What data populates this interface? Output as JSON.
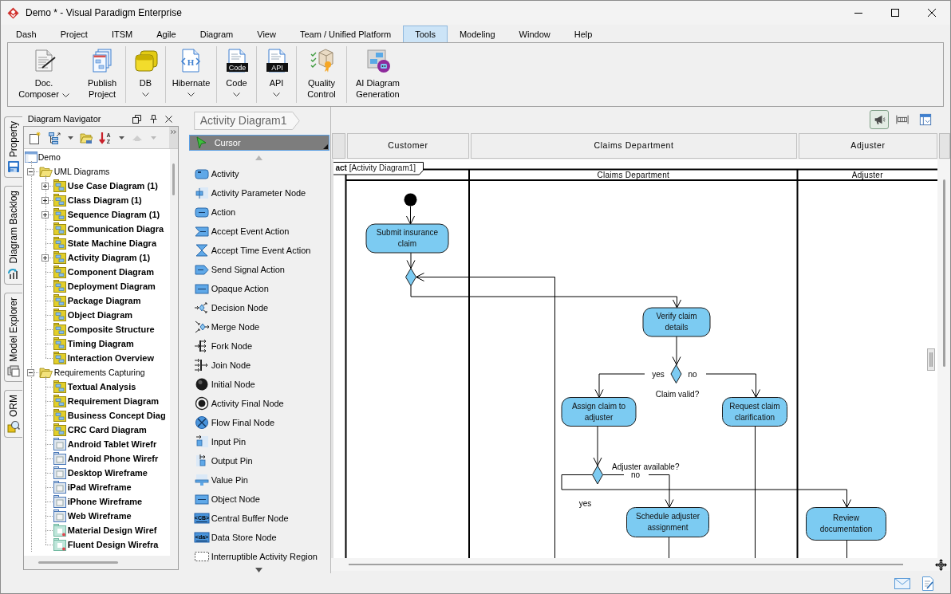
{
  "window": {
    "title": "Demo * - Visual Paradigm Enterprise"
  },
  "menu_tabs": [
    {
      "label": "Dash",
      "selected": false
    },
    {
      "label": "Project",
      "selected": false
    },
    {
      "label": "ITSM",
      "selected": false
    },
    {
      "label": "Agile",
      "selected": false
    },
    {
      "label": "Diagram",
      "selected": false
    },
    {
      "label": "View",
      "selected": false
    },
    {
      "label": "Team / Unified Platform",
      "selected": false
    },
    {
      "label": "Tools",
      "selected": true
    },
    {
      "label": "Modeling",
      "selected": false
    },
    {
      "label": "Window",
      "selected": false
    },
    {
      "label": "Help",
      "selected": false
    }
  ],
  "ribbon": [
    {
      "label": "Doc. Composer",
      "kind": "split"
    },
    {
      "label": "Publish Project",
      "kind": "button"
    },
    {
      "label": "DB",
      "kind": "dropdown"
    },
    {
      "label": "Hibernate",
      "kind": "dropdown",
      "icon_text": "H"
    },
    {
      "label": "Code",
      "kind": "dropdown",
      "icon_text": "Code"
    },
    {
      "label": "API",
      "kind": "dropdown",
      "icon_text": "API"
    },
    {
      "label": "Quality Control",
      "kind": "button"
    },
    {
      "label": "AI Diagram Generation",
      "kind": "button"
    }
  ],
  "side_tabs": [
    {
      "label": "Property"
    },
    {
      "label": "Diagram Backlog"
    },
    {
      "label": "Model Explorer"
    },
    {
      "label": "ORM"
    }
  ],
  "navigator": {
    "title": "Diagram Navigator",
    "toolbar": [
      {
        "disabled": false
      },
      {
        "disabled": false
      },
      {
        "disabled": false
      },
      {
        "disabled": false,
        "icon_text": "AZ"
      },
      {
        "disabled": true
      }
    ],
    "tree": {
      "label": "Demo",
      "children": [
        {
          "label": "UML Diagrams",
          "kind": "folder",
          "has_children": true,
          "expanded": true,
          "children": [
            {
              "label": "Use Case Diagram (1)",
              "kind": "diagram",
              "has_children": true,
              "expanded": false
            },
            {
              "label": "Class Diagram (1)",
              "kind": "diagram",
              "has_children": true,
              "expanded": false
            },
            {
              "label": "Sequence Diagram (1)",
              "kind": "diagram",
              "has_children": true,
              "expanded": false
            },
            {
              "label": "Communication Diagra",
              "kind": "diagram",
              "has_children": false,
              "expanded": false
            },
            {
              "label": "State Machine Diagra",
              "kind": "diagram",
              "has_children": false,
              "expanded": false
            },
            {
              "label": "Activity Diagram (1)",
              "kind": "diagram",
              "has_children": true,
              "expanded": false
            },
            {
              "label": "Component Diagram",
              "kind": "diagram",
              "has_children": false,
              "expanded": false
            },
            {
              "label": "Deployment Diagram",
              "kind": "diagram",
              "has_children": false,
              "expanded": false
            },
            {
              "label": "Package Diagram",
              "kind": "diagram",
              "has_children": false,
              "expanded": false
            },
            {
              "label": "Object Diagram",
              "kind": "diagram",
              "has_children": false,
              "expanded": false
            },
            {
              "label": "Composite Structure",
              "kind": "diagram",
              "has_children": false,
              "expanded": false
            },
            {
              "label": "Timing Diagram",
              "kind": "diagram",
              "has_children": false,
              "expanded": false
            },
            {
              "label": "Interaction Overview",
              "kind": "diagram",
              "has_children": false,
              "expanded": false
            }
          ]
        },
        {
          "label": "Requirements Capturing",
          "kind": "folder",
          "has_children": true,
          "expanded": true,
          "children": [
            {
              "label": "Textual Analysis",
              "kind": "diagram",
              "has_children": false,
              "expanded": false
            },
            {
              "label": "Requirement Diagram",
              "kind": "diagram",
              "has_children": false,
              "expanded": false
            },
            {
              "label": "Business Concept Diag",
              "kind": "diagram",
              "has_children": false,
              "expanded": false
            },
            {
              "label": "CRC Card Diagram",
              "kind": "diagram",
              "has_children": false,
              "expanded": false
            },
            {
              "label": "Android Tablet Wirefr",
              "kind": "diagram",
              "has_children": false,
              "expanded": false
            },
            {
              "label": "Android Phone Wirefr",
              "kind": "diagram",
              "has_children": false,
              "expanded": false
            },
            {
              "label": "Desktop Wireframe",
              "kind": "diagram",
              "has_children": false,
              "expanded": false
            },
            {
              "label": "iPad Wireframe",
              "kind": "diagram",
              "has_children": false,
              "expanded": false
            },
            {
              "label": "iPhone Wireframe",
              "kind": "diagram",
              "has_children": false,
              "expanded": false
            },
            {
              "label": "Web Wireframe",
              "kind": "diagram",
              "has_children": false,
              "expanded": false
            },
            {
              "label": "Material Design Wiref",
              "kind": "diagram",
              "has_children": false,
              "expanded": false
            },
            {
              "label": "Fluent Design Wirefra",
              "kind": "diagram",
              "has_children": false,
              "expanded": false
            }
          ]
        }
      ]
    }
  },
  "palette": {
    "tab": "Activity Diagram1",
    "cursor": {
      "label": "Cursor",
      "selected": true
    },
    "items": [
      {
        "label": "Activity",
        "selected": false
      },
      {
        "label": "Activity Parameter Node",
        "selected": false
      },
      {
        "label": "Action",
        "selected": false
      },
      {
        "label": "Accept Event Action",
        "selected": false
      },
      {
        "label": "Accept Time Event Action",
        "selected": false
      },
      {
        "label": "Send Signal Action",
        "selected": false
      },
      {
        "label": "Opaque Action",
        "selected": false
      },
      {
        "label": "Decision Node",
        "selected": false
      },
      {
        "label": "Merge Node",
        "selected": false
      },
      {
        "label": "Fork Node",
        "selected": false
      },
      {
        "label": "Join Node",
        "selected": false
      },
      {
        "label": "Initial Node",
        "selected": false
      },
      {
        "label": "Activity Final Node",
        "selected": false
      },
      {
        "label": "Flow Final Node",
        "selected": false
      },
      {
        "label": "Input Pin",
        "selected": false
      },
      {
        "label": "Output Pin",
        "selected": false
      },
      {
        "label": "Value Pin",
        "selected": false
      },
      {
        "label": "Object Node",
        "selected": false
      },
      {
        "label": "Central Buffer Node",
        "selected": false,
        "icon_text": "<CB>"
      },
      {
        "label": "Data Store Node",
        "selected": false,
        "icon_text": "<da>"
      },
      {
        "label": "Interruptible Activity Region",
        "selected": false
      }
    ]
  },
  "diagram": {
    "toolbar": [
      {
        "on": true
      },
      {
        "on": false
      },
      {
        "on": false
      }
    ],
    "lanes": [
      {
        "header": "Customer"
      },
      {
        "header": "Claims Department",
        "name": "Claims Department"
      },
      {
        "header": "Adjuster",
        "name": "Adjuster"
      }
    ],
    "frame_label": "**act** [Activity Diagram1]",
    "nodes": [
      {
        "kind": "initial"
      },
      {
        "kind": "action",
        "label": "Submit insurance claim"
      },
      {
        "kind": "decision"
      },
      {
        "kind": "action",
        "label": "Verify claim details"
      },
      {
        "kind": "decision",
        "label": "Claim valid?"
      },
      {
        "kind": "action",
        "label": "Assign claim to adjuster"
      },
      {
        "kind": "action",
        "label": "Request claim clarification"
      },
      {
        "kind": "decision",
        "label": "Adjuster available?"
      },
      {
        "kind": "action",
        "label": "Schedule adjuster assignment"
      },
      {
        "kind": "action",
        "label": "Review documentation"
      }
    ],
    "guards": [
      "yes",
      "no",
      "no",
      "yes"
    ]
  }
}
